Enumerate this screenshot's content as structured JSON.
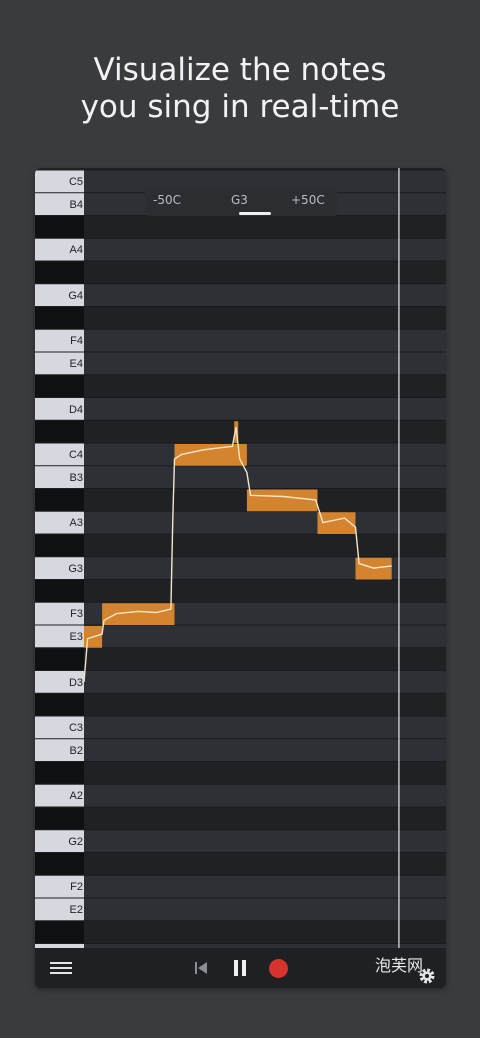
{
  "headline": {
    "line1": "Visualize the notes",
    "line2": "you sing in real-time"
  },
  "tuner": {
    "left_label": "-50C",
    "note": "G3",
    "right_label": "+50C"
  },
  "keyboard": {
    "labels": [
      "C5",
      "B4",
      "A4",
      "G4",
      "F4",
      "E4",
      "D4",
      "C4",
      "B3",
      "A3",
      "G3",
      "F3",
      "E3",
      "D3",
      "C3",
      "B2",
      "A2",
      "G2",
      "F2",
      "E2"
    ]
  },
  "colors": {
    "accent_note": "#d4842e",
    "pitch_line": "#f3e6cc",
    "record": "#d8332c",
    "white_key": "#d5d8de",
    "black_key": "#0f1012"
  },
  "toolbar": {
    "menu_icon": "hamburger-menu-icon",
    "rewind_icon": "skip-back-icon",
    "pause_icon": "pause-icon",
    "record_icon": "record-icon",
    "settings_icon": "gear-icon",
    "watermark": "泡芙网"
  },
  "detected_notes": [
    "E3",
    "F3",
    "C4",
    "A#3",
    "A3",
    "G3"
  ]
}
